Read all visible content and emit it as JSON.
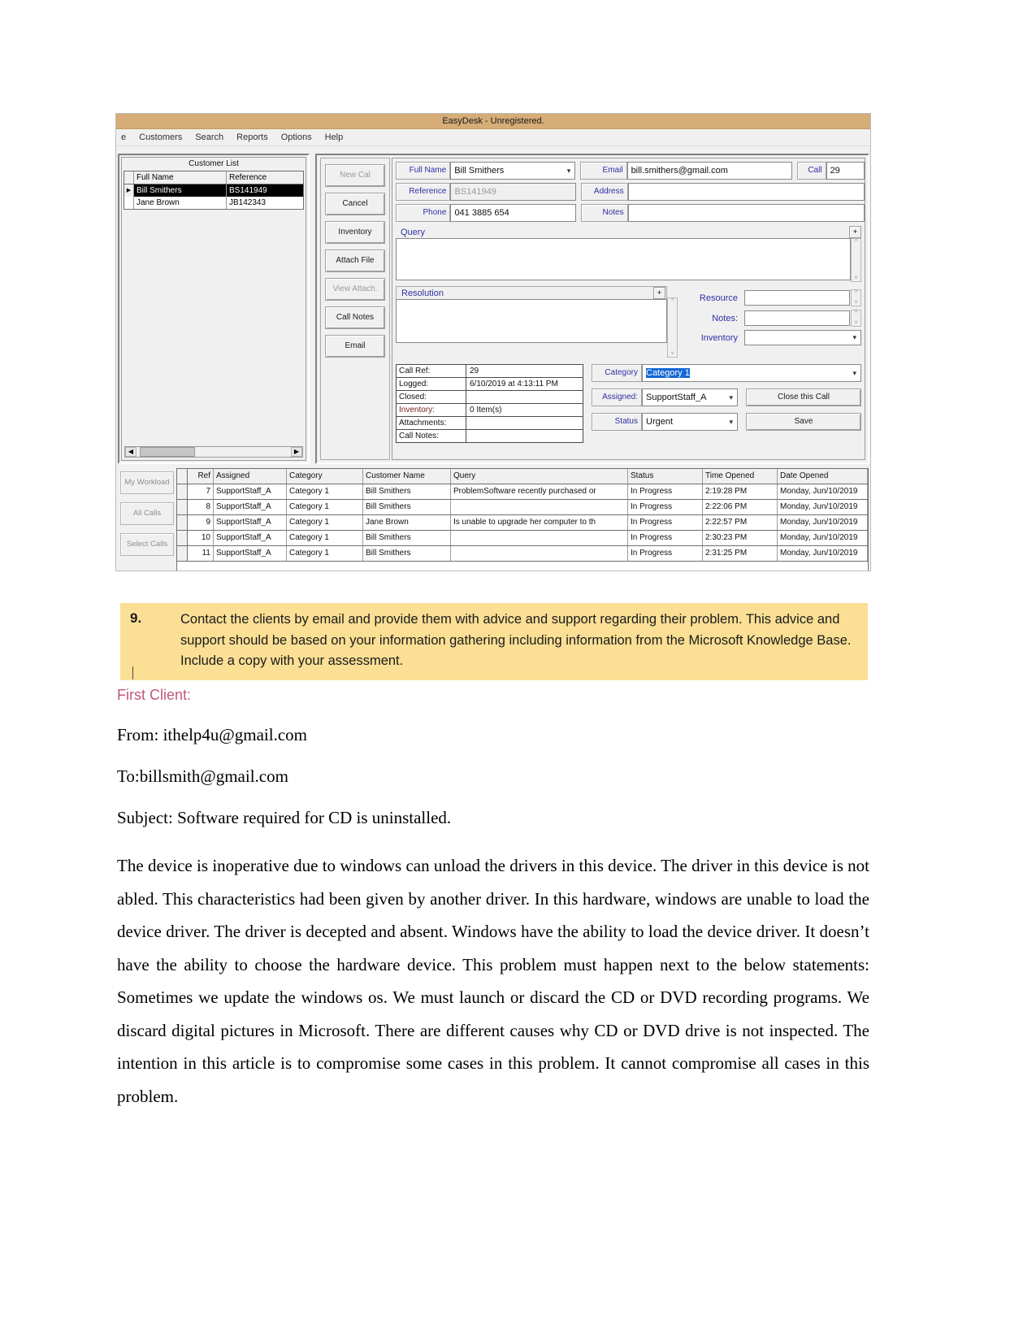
{
  "app": {
    "title": "EasyDesk - Unregistered.",
    "menu": [
      "e",
      "Customers",
      "Search",
      "Reports",
      "Options",
      "Help"
    ],
    "customer_list": {
      "title": "Customer List",
      "columns": [
        "Full Name",
        "Reference"
      ],
      "rows": [
        {
          "full_name": "Bill Smithers",
          "reference": "BS141949",
          "selected": true
        },
        {
          "full_name": "Jane Brown",
          "reference": "JB142343",
          "selected": false
        }
      ]
    },
    "side_buttons": [
      {
        "label": "New Cal",
        "disabled": true
      },
      {
        "label": "Cancel",
        "disabled": false
      },
      {
        "label": "Inventory",
        "disabled": false
      },
      {
        "label": "Attach File",
        "disabled": false
      },
      {
        "label": "View Attach.",
        "disabled": true
      },
      {
        "label": "Call Notes",
        "disabled": false
      },
      {
        "label": "Email",
        "disabled": false
      }
    ],
    "form": {
      "full_name_label": "Full Name",
      "full_name_value": "Bill Smithers",
      "reference_label": "Reference",
      "reference_value": "BS141949",
      "phone_label": "Phone",
      "phone_value": "041 3885 654",
      "email_label": "Email",
      "email_value": "bill.smithers@gmail.com",
      "address_label": "Address",
      "address_value": "",
      "notes_label": "Notes",
      "notes_value": "",
      "call_label": "Call",
      "call_value": "29",
      "query_label": "Query",
      "query_value": "",
      "resolution_label": "Resolution",
      "resolution_value": "",
      "resource_label": "Resource",
      "resource_value": "",
      "res_notes_label": "Notes:",
      "res_notes_value": "",
      "inventory_label": "Inventory",
      "inventory_value": "",
      "expand_label": "+"
    },
    "call_info": {
      "rows": [
        {
          "key": "Call Ref:",
          "value": "29"
        },
        {
          "key": "Logged:",
          "value": "6/10/2019  at  4:13:11 PM"
        },
        {
          "key": "Closed:",
          "value": ""
        },
        {
          "key": "Inventory:",
          "value": "0 Item(s)"
        },
        {
          "key": "Attachments:",
          "value": ""
        },
        {
          "key": "Call Notes:",
          "value": ""
        }
      ]
    },
    "assignment": {
      "category_label": "Category",
      "category_value": "Category 1",
      "assigned_label": "Assigned:",
      "assigned_value": "SupportStaff_A",
      "status_label": "Status",
      "status_value": "Urgent",
      "close_call_label": "Close this Call",
      "save_label": "Save"
    },
    "bottom_tabs": [
      "My Workload",
      "All Calls",
      "Select Calls"
    ],
    "calls_grid": {
      "columns": [
        "Ref",
        "Assigned",
        "Category",
        "Customer Name",
        "Query",
        "Status",
        "Time Opened",
        "Date Opened"
      ],
      "rows": [
        {
          "ref": "7",
          "assigned": "SupportStaff_A",
          "category": "Category 1",
          "customer": "Bill Smithers",
          "query": "ProblemSoftware recently purchased or",
          "status": "In Progress",
          "time": "2:19:28 PM",
          "date": "Monday, Jun/10/2019"
        },
        {
          "ref": "8",
          "assigned": "SupportStaff_A",
          "category": "Category 1",
          "customer": "Bill Smithers",
          "query": "",
          "status": "In Progress",
          "time": "2:22:06 PM",
          "date": "Monday, Jun/10/2019"
        },
        {
          "ref": "9",
          "assigned": "SupportStaff_A",
          "category": "Category 1",
          "customer": "Jane Brown",
          "query": "Is unable to upgrade her computer to th",
          "status": "In Progress",
          "time": "2:22:57 PM",
          "date": "Monday, Jun/10/2019"
        },
        {
          "ref": "10",
          "assigned": "SupportStaff_A",
          "category": "Category 1",
          "customer": "Bill Smithers",
          "query": "",
          "status": "In Progress",
          "time": "2:30:23 PM",
          "date": "Monday, Jun/10/2019"
        },
        {
          "ref": "11",
          "assigned": "SupportStaff_A",
          "category": "Category 1",
          "customer": "Bill Smithers",
          "query": "",
          "status": "In Progress",
          "time": "2:31:25 PM",
          "date": "Monday, Jun/10/2019"
        }
      ]
    }
  },
  "callout": {
    "number": "9.",
    "text": "Contact the clients by email and provide them with advice and support regarding their problem. This advice and support should be based on your information gathering including information from the Microsoft Knowledge Base. Include a copy with your assessment."
  },
  "document": {
    "heading": "First Client:",
    "from": "From: ithelp4u@gmail.com",
    "to": "To:billsmith@gmail.com",
    "subject": "Subject: Software required for CD is uninstalled.",
    "paragraph": "The device is inoperative due to windows can unload the drivers in this device. The driver in this device is not abled. This characteristics had been given by another driver. In this hardware, windows are unable to load the device driver. The driver is decepted and absent. Windows have the ability to load the device driver. It doesn’t have the ability to choose the hardware device. This problem must happen next to the below statements: Sometimes we update the windows os. We must launch or discard the CD or DVD recording programs. We discard digital pictures in Microsoft. There are different causes why CD or DVD drive is not inspected. The intention in this article is to compromise some cases in this problem. It cannot compromise all cases in this problem."
  },
  "colors": {
    "titlebar": "#d6ac77",
    "callout_bg": "#fadf94",
    "heading": "#c0567f",
    "field_label": "#2f2fa5",
    "selection": "#1467d6"
  }
}
